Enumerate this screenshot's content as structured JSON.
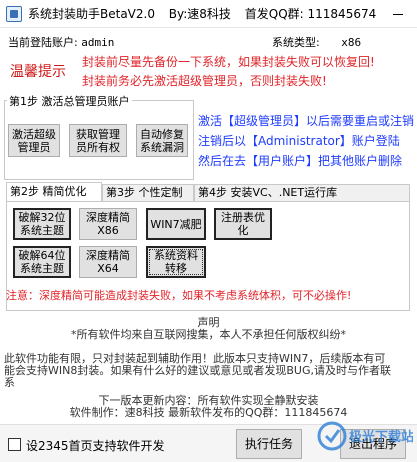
{
  "window": {
    "app_name": "系统封装助手BetaV2.0",
    "author": "By:速8科技",
    "group": "首发QQ群: 111845674"
  },
  "info": {
    "account_label": "当前登陆账户:",
    "account_value": "admin",
    "systype_label": "系统类型:",
    "systype_value": "x86"
  },
  "tips": {
    "label": "温馨提示",
    "line1": "封装前尽量先备份一下系统，如果封装失败可以恢复回!",
    "line2": "封装前务必先激活超级管理员，否则封装失败!"
  },
  "step1": {
    "title": "第1步 激活总管理员账户",
    "buttons": [
      "激活超级\n管理员",
      "获取管理\n员所有权",
      "自动修复\n系统漏洞"
    ],
    "help": [
      "激活【超级管理员】以后需要重启或注销",
      "注销后以【Administrator】账户登陆",
      "然后在去【用户账户】把其他账户删除"
    ]
  },
  "tabs": [
    "第2步 精简优化",
    "第3步 个性定制",
    "第4步 安装VC、.NET运行库"
  ],
  "step2": {
    "buttons": [
      "破解32位\n系统主题",
      "深度精简\nX86",
      "WIN7减肥",
      "注册表优\n化",
      "破解64位\n系统主题",
      "深度精简\nX64",
      "系统资料\n转移"
    ]
  },
  "warning": "注意：深度精简可能造成封装失败，如果不考虑系统体积，可不必操作!",
  "notice": {
    "title": "声明",
    "line1": "*所有软件均来自互联网搜集，本人不承担任何版权纠纷*",
    "line2": "此软件功能有限，只对封装起到辅助作用！此版本只支持WIN7，后续版本有可",
    "line3": "能会支持WIN8封装。如果有什么好的建议或意见或者发现BUG,请及时与作者联",
    "line4": "系",
    "line5": "下一版本更新内容：所有软件实现全静默安装",
    "line6": "软件制作：速8科技       最新软件发布的QQ群：111845674"
  },
  "bottom": {
    "checkbox_label": "设2345首页支持软件开发",
    "run_button": "执行任务",
    "exit_button": "退出程序"
  },
  "watermark_text": "极光下载站"
}
